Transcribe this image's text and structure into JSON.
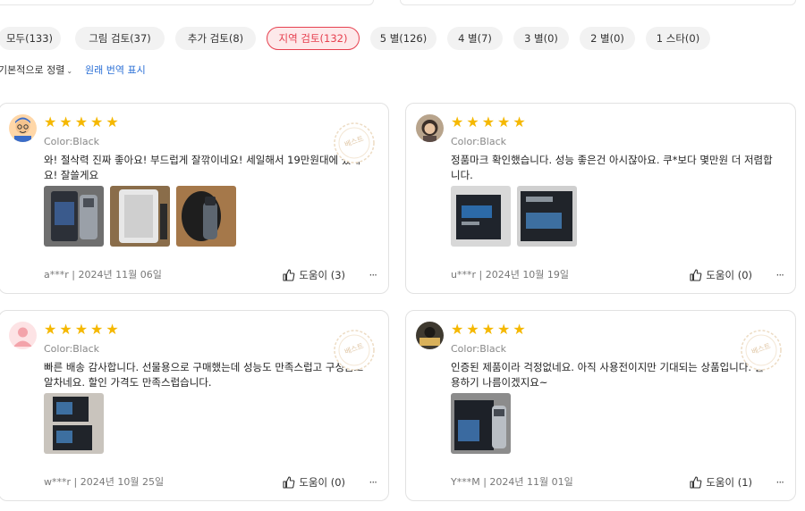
{
  "filters": [
    {
      "label": "모두(133)",
      "active": false
    },
    {
      "label": "그림 검토(37)",
      "active": false
    },
    {
      "label": "추가 검토(8)",
      "active": false
    },
    {
      "label": "지역 검토(132)",
      "active": true
    },
    {
      "label": "5 별(126)",
      "active": false
    },
    {
      "label": "4 별(7)",
      "active": false
    },
    {
      "label": "3 별(0)",
      "active": false
    },
    {
      "label": "2 별(0)",
      "active": false
    },
    {
      "label": "1 스타(0)",
      "active": false
    }
  ],
  "sort": {
    "label": "기본적으로 정렬",
    "show_original": "원래 번역 표시"
  },
  "reviews": [
    {
      "rating": 5,
      "color": "Color:Black",
      "text": "와! 절삭력 진짜 좋아요! 부드럽게 잘깎이네요! 세일해서 19만원대에 샀네요! 잘쓸게요",
      "author": "a***r",
      "date": "2024년 11월 06일",
      "helpful": "도움이 (3)",
      "badge": "베스트",
      "photo_count": 3
    },
    {
      "rating": 5,
      "color": "Color:Black",
      "text": "정품마크 확인했습니다. 성능 좋은건 아시잖아요. 쿠*보다 몇만원 더 저렴합니다.",
      "author": "u***r",
      "date": "2024년 10월 19일",
      "helpful": "도움이 (0)",
      "badge": "",
      "photo_count": 2
    },
    {
      "rating": 5,
      "color": "Color:Black",
      "text": "빠른 배송 감사합니다. 선물용으로 구매했는데 성능도 만족스럽고 구성품도 알차네요. 할인 가격도 만족스럽습니다.",
      "author": "w***r",
      "date": "2024년 10월 25일",
      "helpful": "도움이 (0)",
      "badge": "베스트",
      "photo_count": 1
    },
    {
      "rating": 5,
      "color": "Color:Black",
      "text": "인증된 제품이라 걱정없네요. 아직 사용전이지만 기대되는 상품입니다. 활용하기 나름이겠지요~",
      "author": "Y***M",
      "date": "2024년 11월 01일",
      "helpful": "도움이 (1)",
      "badge": "베스트",
      "photo_count": 1
    }
  ],
  "icons": {
    "rating": "star-icon",
    "helpful": "thumbs-up-icon",
    "more": "more-dots-icon",
    "sort": "chevron-down-icon"
  },
  "colors": {
    "accent": "#e6404f",
    "star": "#f5b800",
    "link": "#2a6fd6"
  }
}
